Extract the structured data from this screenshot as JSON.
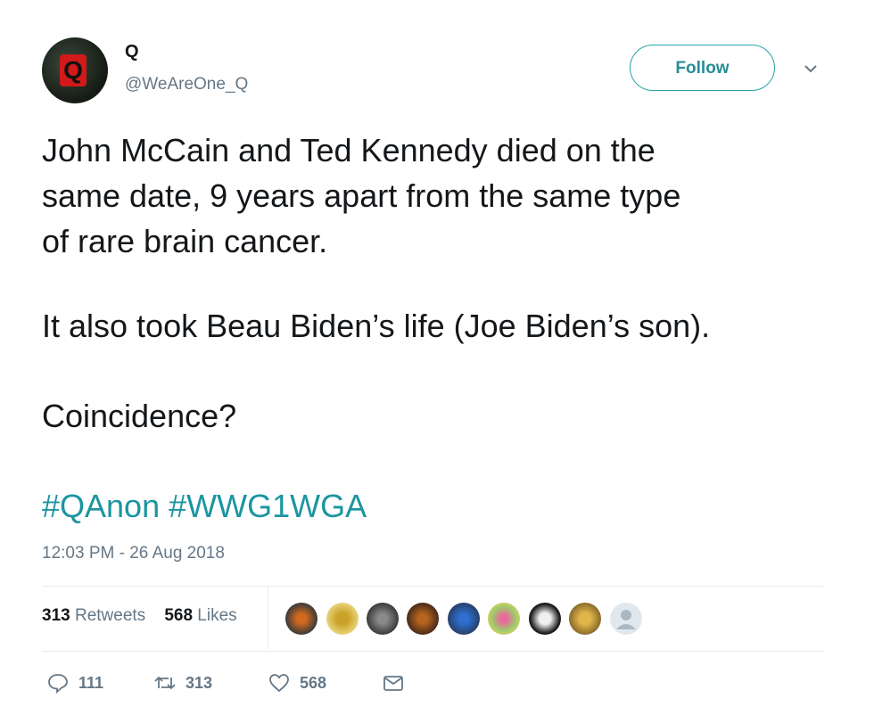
{
  "author": {
    "display_name": "Q",
    "handle": "@WeAreOne_Q",
    "avatar_icon": "q-logo-avatar"
  },
  "follow_label": "Follow",
  "tweet": {
    "line1": "John McCain and Ted Kennedy died on the",
    "line2": "same date, 9 years apart from the same type",
    "line3": "of rare brain cancer.",
    "para2": "It also took Beau Biden’s life (Joe Biden’s son).",
    "para3": "Coincidence?",
    "hashtag1": "#QAnon",
    "hashtag2": "#WWG1WGA",
    "timestamp": "12:03 PM - 26 Aug 2018"
  },
  "stats": {
    "retweets_count": "313",
    "retweets_label": "Retweets",
    "likes_count": "568",
    "likes_label": "Likes"
  },
  "actions": {
    "reply_count": "111",
    "retweet_count": "313",
    "like_count": "568"
  },
  "colors": {
    "accent": "#1b95a0",
    "muted": "#657786",
    "text": "#14171a"
  }
}
